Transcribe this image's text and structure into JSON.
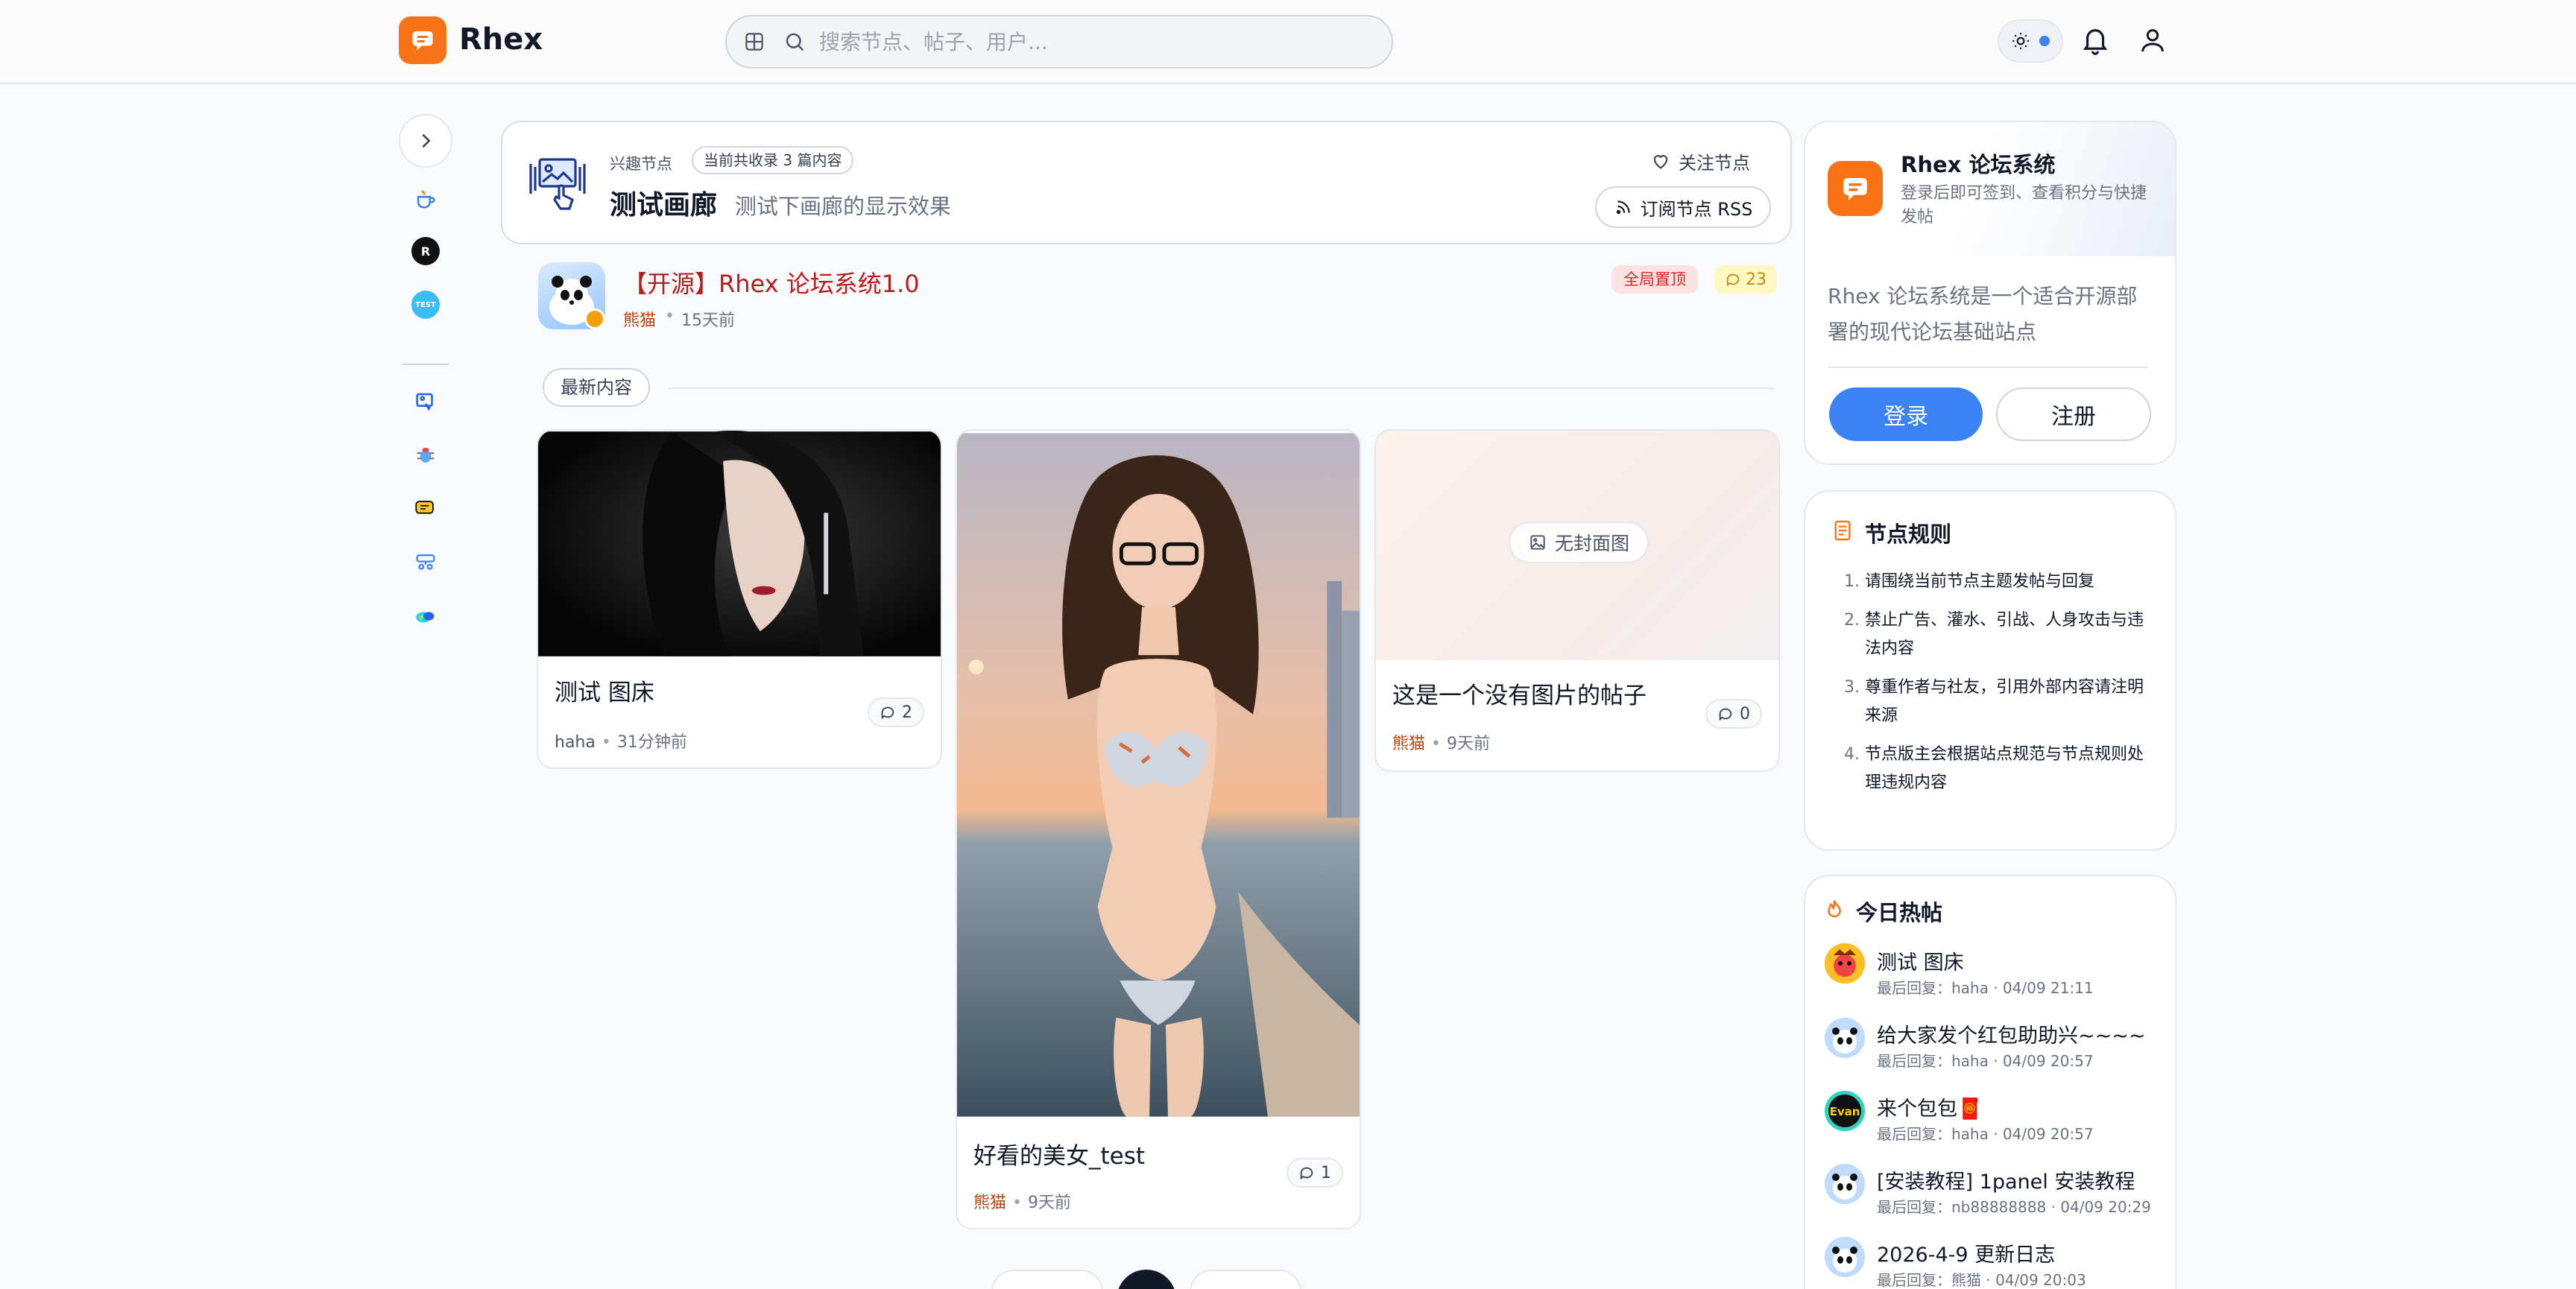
{
  "header": {
    "brand": "Rhex",
    "search_placeholder": "搜索节点、帖子、用户..."
  },
  "node": {
    "tag": "兴趣节点",
    "count": "当前共收录 3 篇内容",
    "title": "测试画廊",
    "subtitle": "测试下画廊的显示效果",
    "follow_label": "关注节点",
    "rss_label": "订阅节点 RSS"
  },
  "pinned": {
    "title": "【开源】Rhex 论坛系统1.0",
    "author": "熊猫",
    "time": "15天前",
    "badge": "全局置顶",
    "comments": "23"
  },
  "latest_label": "最新内容",
  "gallery": [
    {
      "title": "测试 图床",
      "author": "haha",
      "time": "31分钟前",
      "comments": "2"
    },
    {
      "title": "好看的美女_test",
      "author": "熊猫",
      "time": "9天前",
      "comments": "1"
    },
    {
      "title": "这是一个没有图片的帖子",
      "author": "熊猫",
      "time": "9天前",
      "comments": "0",
      "no_cover": "无封面图"
    }
  ],
  "login_panel": {
    "title": "Rhex 论坛系统",
    "subtitle": "登录后即可签到、查看积分与快捷发帖",
    "description": "Rhex 论坛系统是一个适合开源部署的现代论坛基础站点",
    "login_label": "登录",
    "register_label": "注册"
  },
  "rules": {
    "title": "节点规则",
    "items": [
      "请围绕当前节点主题发帖与回复",
      "禁止广告、灌水、引战、人身攻击与违法内容",
      "尊重作者与社友，引用外部内容请注明来源",
      "节点版主会根据站点规范与节点规则处理违规内容"
    ]
  },
  "hot": {
    "title": "今日热帖",
    "items": [
      {
        "title": "测试 图床",
        "meta": "最后回复：haha · 04/09 21:11"
      },
      {
        "title": "给大家发个红包助助兴~~~~",
        "meta": "最后回复：haha · 04/09 20:57"
      },
      {
        "title": "来个包包🧧",
        "meta": "最后回复：haha · 04/09 20:57"
      },
      {
        "title": "[安装教程] 1panel 安装教程",
        "meta": "最后回复：nb88888888 · 04/09 20:29"
      },
      {
        "title": "2026-4-9 更新日志",
        "meta": "最后回复：熊猫 · 04/09 20:03"
      }
    ]
  },
  "colors": {
    "brand": "#f97316",
    "primary": "#3b82f6",
    "pin_title": "#b91c1c",
    "author": "#c2410c"
  }
}
